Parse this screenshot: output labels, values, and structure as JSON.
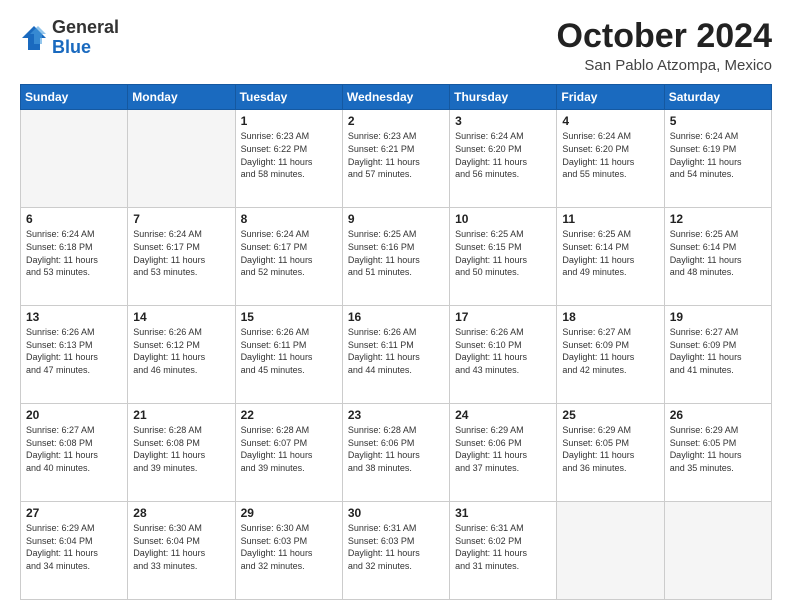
{
  "header": {
    "logo_general": "General",
    "logo_blue": "Blue",
    "month_title": "October 2024",
    "location": "San Pablo Atzompa, Mexico"
  },
  "weekdays": [
    "Sunday",
    "Monday",
    "Tuesday",
    "Wednesday",
    "Thursday",
    "Friday",
    "Saturday"
  ],
  "weeks": [
    [
      {
        "day": "",
        "info": ""
      },
      {
        "day": "",
        "info": ""
      },
      {
        "day": "1",
        "info": "Sunrise: 6:23 AM\nSunset: 6:22 PM\nDaylight: 11 hours\nand 58 minutes."
      },
      {
        "day": "2",
        "info": "Sunrise: 6:23 AM\nSunset: 6:21 PM\nDaylight: 11 hours\nand 57 minutes."
      },
      {
        "day": "3",
        "info": "Sunrise: 6:24 AM\nSunset: 6:20 PM\nDaylight: 11 hours\nand 56 minutes."
      },
      {
        "day": "4",
        "info": "Sunrise: 6:24 AM\nSunset: 6:20 PM\nDaylight: 11 hours\nand 55 minutes."
      },
      {
        "day": "5",
        "info": "Sunrise: 6:24 AM\nSunset: 6:19 PM\nDaylight: 11 hours\nand 54 minutes."
      }
    ],
    [
      {
        "day": "6",
        "info": "Sunrise: 6:24 AM\nSunset: 6:18 PM\nDaylight: 11 hours\nand 53 minutes."
      },
      {
        "day": "7",
        "info": "Sunrise: 6:24 AM\nSunset: 6:17 PM\nDaylight: 11 hours\nand 53 minutes."
      },
      {
        "day": "8",
        "info": "Sunrise: 6:24 AM\nSunset: 6:17 PM\nDaylight: 11 hours\nand 52 minutes."
      },
      {
        "day": "9",
        "info": "Sunrise: 6:25 AM\nSunset: 6:16 PM\nDaylight: 11 hours\nand 51 minutes."
      },
      {
        "day": "10",
        "info": "Sunrise: 6:25 AM\nSunset: 6:15 PM\nDaylight: 11 hours\nand 50 minutes."
      },
      {
        "day": "11",
        "info": "Sunrise: 6:25 AM\nSunset: 6:14 PM\nDaylight: 11 hours\nand 49 minutes."
      },
      {
        "day": "12",
        "info": "Sunrise: 6:25 AM\nSunset: 6:14 PM\nDaylight: 11 hours\nand 48 minutes."
      }
    ],
    [
      {
        "day": "13",
        "info": "Sunrise: 6:26 AM\nSunset: 6:13 PM\nDaylight: 11 hours\nand 47 minutes."
      },
      {
        "day": "14",
        "info": "Sunrise: 6:26 AM\nSunset: 6:12 PM\nDaylight: 11 hours\nand 46 minutes."
      },
      {
        "day": "15",
        "info": "Sunrise: 6:26 AM\nSunset: 6:11 PM\nDaylight: 11 hours\nand 45 minutes."
      },
      {
        "day": "16",
        "info": "Sunrise: 6:26 AM\nSunset: 6:11 PM\nDaylight: 11 hours\nand 44 minutes."
      },
      {
        "day": "17",
        "info": "Sunrise: 6:26 AM\nSunset: 6:10 PM\nDaylight: 11 hours\nand 43 minutes."
      },
      {
        "day": "18",
        "info": "Sunrise: 6:27 AM\nSunset: 6:09 PM\nDaylight: 11 hours\nand 42 minutes."
      },
      {
        "day": "19",
        "info": "Sunrise: 6:27 AM\nSunset: 6:09 PM\nDaylight: 11 hours\nand 41 minutes."
      }
    ],
    [
      {
        "day": "20",
        "info": "Sunrise: 6:27 AM\nSunset: 6:08 PM\nDaylight: 11 hours\nand 40 minutes."
      },
      {
        "day": "21",
        "info": "Sunrise: 6:28 AM\nSunset: 6:08 PM\nDaylight: 11 hours\nand 39 minutes."
      },
      {
        "day": "22",
        "info": "Sunrise: 6:28 AM\nSunset: 6:07 PM\nDaylight: 11 hours\nand 39 minutes."
      },
      {
        "day": "23",
        "info": "Sunrise: 6:28 AM\nSunset: 6:06 PM\nDaylight: 11 hours\nand 38 minutes."
      },
      {
        "day": "24",
        "info": "Sunrise: 6:29 AM\nSunset: 6:06 PM\nDaylight: 11 hours\nand 37 minutes."
      },
      {
        "day": "25",
        "info": "Sunrise: 6:29 AM\nSunset: 6:05 PM\nDaylight: 11 hours\nand 36 minutes."
      },
      {
        "day": "26",
        "info": "Sunrise: 6:29 AM\nSunset: 6:05 PM\nDaylight: 11 hours\nand 35 minutes."
      }
    ],
    [
      {
        "day": "27",
        "info": "Sunrise: 6:29 AM\nSunset: 6:04 PM\nDaylight: 11 hours\nand 34 minutes."
      },
      {
        "day": "28",
        "info": "Sunrise: 6:30 AM\nSunset: 6:04 PM\nDaylight: 11 hours\nand 33 minutes."
      },
      {
        "day": "29",
        "info": "Sunrise: 6:30 AM\nSunset: 6:03 PM\nDaylight: 11 hours\nand 32 minutes."
      },
      {
        "day": "30",
        "info": "Sunrise: 6:31 AM\nSunset: 6:03 PM\nDaylight: 11 hours\nand 32 minutes."
      },
      {
        "day": "31",
        "info": "Sunrise: 6:31 AM\nSunset: 6:02 PM\nDaylight: 11 hours\nand 31 minutes."
      },
      {
        "day": "",
        "info": ""
      },
      {
        "day": "",
        "info": ""
      }
    ]
  ]
}
